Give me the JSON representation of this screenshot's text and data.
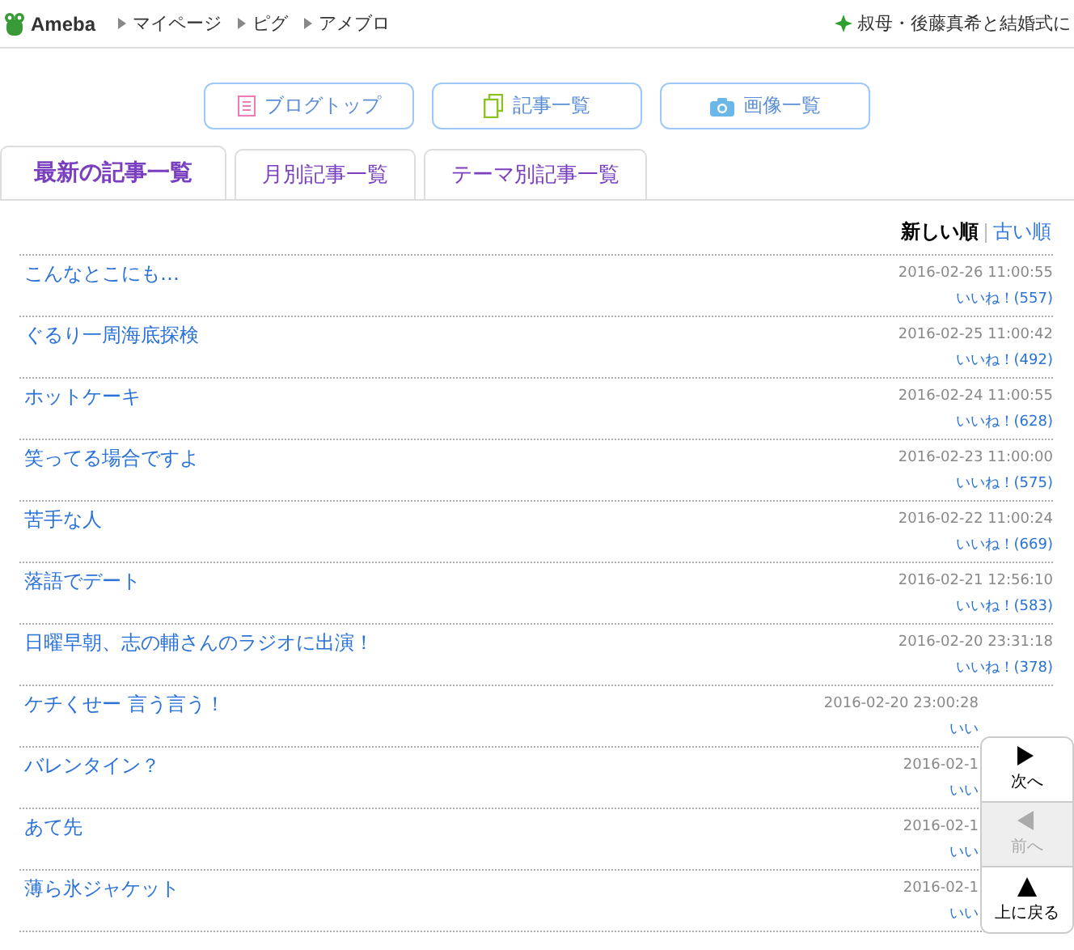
{
  "header": {
    "logo": "Ameba",
    "links": [
      "マイページ",
      "ピグ",
      "アメブロ"
    ],
    "news": "叔母・後藤真希と結婚式に"
  },
  "buttons": [
    {
      "label": "ブログトップ"
    },
    {
      "label": "記事一覧"
    },
    {
      "label": "画像一覧"
    }
  ],
  "tabs": [
    {
      "label": "最新の記事一覧",
      "selected": true
    },
    {
      "label": "月別記事一覧",
      "selected": false
    },
    {
      "label": "テーマ別記事一覧",
      "selected": false
    }
  ],
  "sort": [
    {
      "label": "新しい順",
      "selected": true
    },
    {
      "label": "古い順",
      "selected": false
    }
  ],
  "articles": [
    {
      "title": "こんなとこにも…",
      "date": "2016-02-26 11:00:55",
      "likes": "いいね！(557)",
      "under_nav": false
    },
    {
      "title": "ぐるり一周海底探検",
      "date": "2016-02-25 11:00:42",
      "likes": "いいね！(492)",
      "under_nav": false
    },
    {
      "title": "ホットケーキ",
      "date": "2016-02-24 11:00:55",
      "likes": "いいね！(628)",
      "under_nav": false
    },
    {
      "title": "笑ってる場合ですよ",
      "date": "2016-02-23 11:00:00",
      "likes": "いいね！(575)",
      "under_nav": false
    },
    {
      "title": "苦手な人",
      "date": "2016-02-22 11:00:24",
      "likes": "いいね！(669)",
      "under_nav": false
    },
    {
      "title": "落語でデート",
      "date": "2016-02-21 12:56:10",
      "likes": "いいね！(583)",
      "under_nav": false
    },
    {
      "title": "日曜早朝、志の輔さんのラジオに出演！",
      "date": "2016-02-20 23:31:18",
      "likes": "いいね！(378)",
      "under_nav": false
    },
    {
      "title": "ケチくせー 言う言う！",
      "date": "2016-02-20 23:00:28",
      "likes": "いい",
      "under_nav": true
    },
    {
      "title": "バレンタイン？",
      "date": "2016-02-1",
      "likes": "いい",
      "under_nav": true
    },
    {
      "title": "あて先",
      "date": "2016-02-1",
      "likes": "いい",
      "under_nav": true
    },
    {
      "title": "薄ら氷ジャケット",
      "date": "2016-02-1",
      "likes": "いい",
      "under_nav": true
    }
  ],
  "page_nav": [
    {
      "label": "次へ",
      "kind": "next",
      "disabled": false
    },
    {
      "label": "前へ",
      "kind": "prev",
      "disabled": true
    },
    {
      "label": "上に戻る",
      "kind": "top",
      "disabled": false
    }
  ]
}
